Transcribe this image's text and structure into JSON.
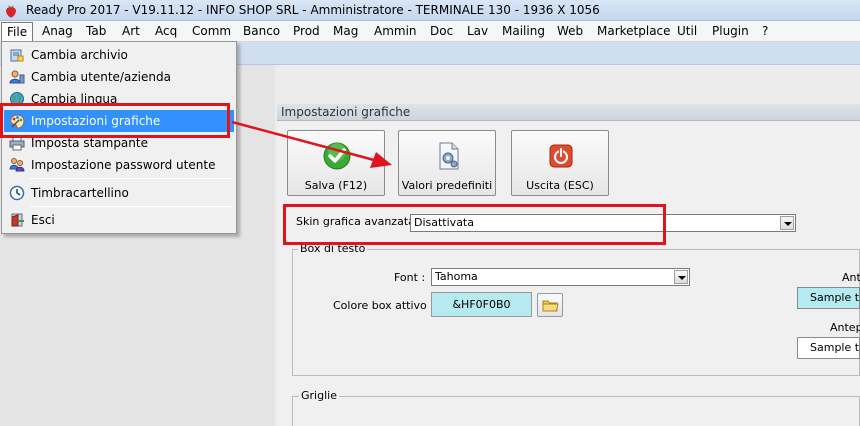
{
  "window": {
    "title": "Ready Pro 2017 - V19.11.12 - INFO SHOP SRL - Amministratore - TERMINALE 130 - 1936 X 1056"
  },
  "menubar": {
    "items": [
      "File",
      "Anag",
      "Tab",
      "Art",
      "Acq",
      "Comm",
      "Banco",
      "Prod",
      "Mag",
      "Ammin",
      "Doc",
      "Lav",
      "Mailing",
      "Web",
      "Marketplace",
      "Util",
      "Plugin",
      "?"
    ]
  },
  "file_menu": {
    "items": [
      {
        "label": "Cambia archivio",
        "icon": "database-icon"
      },
      {
        "label": "Cambia utente/azienda",
        "icon": "user-company-icon"
      },
      {
        "label": "Cambia lingua",
        "icon": "globe-icon"
      },
      {
        "label": "Impostazioni grafiche",
        "icon": "palette-icon"
      },
      {
        "label": "Imposta stampante",
        "icon": "printer-icon"
      },
      {
        "label": "Impostazione password utente",
        "icon": "users-key-icon"
      },
      {
        "label": "Timbracartellino",
        "icon": "clock-icon"
      },
      {
        "label": "Esci",
        "icon": "exit-icon"
      }
    ],
    "highlighted_index": 3
  },
  "panel": {
    "title": "Impostazioni grafiche",
    "buttons": {
      "save": "Salva (F12)",
      "defaults": "Valori predefiniti",
      "exit": "Uscita (ESC)"
    },
    "skin": {
      "label": "Skin grafica avanzata :",
      "value": "Disattivata"
    },
    "text_box_group": {
      "legend": "Box di testo",
      "font_label": "Font :",
      "font_value": "Tahoma",
      "active_color_label": "Colore box attivo :",
      "active_color_value": "&HF0F0B0",
      "active_color": "#b5eaf0",
      "preview_label_1": "Ante",
      "preview_label_2": "Antep",
      "sample_1": "Sample text",
      "sample_2": "Sample text"
    },
    "grid_group": {
      "legend": "Griglie"
    }
  },
  "colors": {
    "highlight": "#3390ff",
    "annotation_red": "#e0141e"
  }
}
